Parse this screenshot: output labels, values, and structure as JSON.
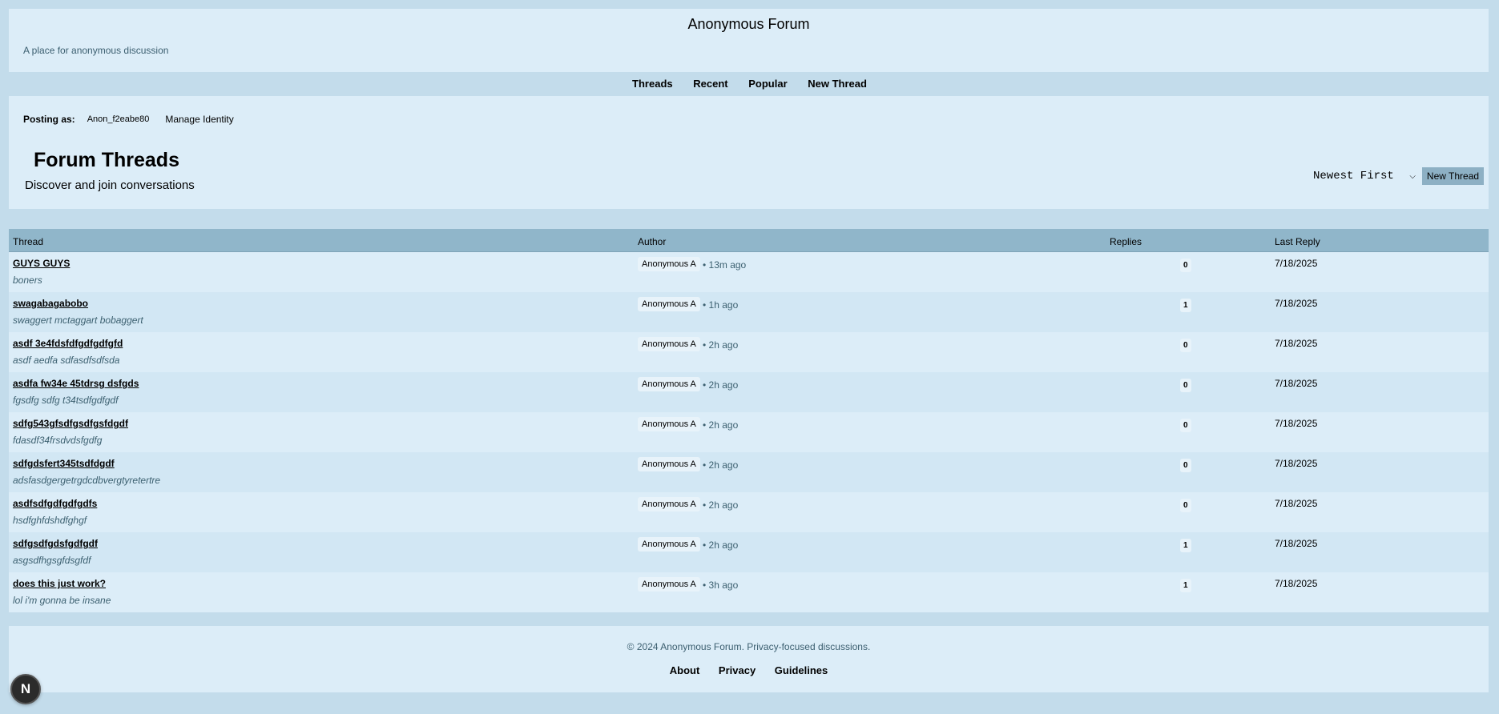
{
  "header": {
    "title": "Anonymous Forum",
    "tagline": "A place for anonymous discussion"
  },
  "nav": [
    "Threads",
    "Recent",
    "Popular",
    "New Thread"
  ],
  "identity": {
    "label": "Posting as:",
    "name": "Anon_f2eabe80",
    "manage": "Manage Identity"
  },
  "page": {
    "title": "Forum Threads",
    "subtitle": "Discover and join conversations"
  },
  "controls": {
    "sort_selected": "Newest First",
    "new_thread_label": "New Thread"
  },
  "table": {
    "headers": [
      "Thread",
      "Author",
      "Replies",
      "Last Reply"
    ],
    "rows": [
      {
        "title": "GUYS GUYS",
        "excerpt": "boners",
        "author": "Anonymous A",
        "time": "• 13m ago",
        "replies": "0",
        "last_reply": "7/18/2025"
      },
      {
        "title": "swagabagabobo",
        "excerpt": "swaggert mctaggart bobaggert",
        "author": "Anonymous A",
        "time": "• 1h ago",
        "replies": "1",
        "last_reply": "7/18/2025"
      },
      {
        "title": "asdf 3e4fdsfdfgdfgdfgfd",
        "excerpt": "asdf aedfa sdfasdfsdfsda",
        "author": "Anonymous A",
        "time": "• 2h ago",
        "replies": "0",
        "last_reply": "7/18/2025"
      },
      {
        "title": "asdfa fw34e 45tdrsg dsfgds",
        "excerpt": "fgsdfg sdfg t34tsdfgdfgdf",
        "author": "Anonymous A",
        "time": "• 2h ago",
        "replies": "0",
        "last_reply": "7/18/2025"
      },
      {
        "title": "sdfg543gfsdfgsdfgsfdgdf",
        "excerpt": "fdasdf34frsdvdsfgdfg",
        "author": "Anonymous A",
        "time": "• 2h ago",
        "replies": "0",
        "last_reply": "7/18/2025"
      },
      {
        "title": "sdfgdsfert345tsdfdgdf",
        "excerpt": "adsfasdgergetrgdcdbvergtyretertre",
        "author": "Anonymous A",
        "time": "• 2h ago",
        "replies": "0",
        "last_reply": "7/18/2025"
      },
      {
        "title": "asdfsdfgdfgdfgdfs",
        "excerpt": "hsdfghfdshdfghgf",
        "author": "Anonymous A",
        "time": "• 2h ago",
        "replies": "0",
        "last_reply": "7/18/2025"
      },
      {
        "title": "sdfgsdfgdsfgdfgdf",
        "excerpt": "asgsdfhgsgfdsgfdf",
        "author": "Anonymous A",
        "time": "• 2h ago",
        "replies": "1",
        "last_reply": "7/18/2025"
      },
      {
        "title": "does this just work?",
        "excerpt": "lol i'm gonna be insane",
        "author": "Anonymous A",
        "time": "• 3h ago",
        "replies": "1",
        "last_reply": "7/18/2025"
      }
    ]
  },
  "footer": {
    "copyright": "© 2024 Anonymous Forum. Privacy-focused discussions.",
    "links": [
      "About",
      "Privacy",
      "Guidelines"
    ]
  },
  "fab": {
    "label": "N",
    "icon": "next-logo-icon"
  }
}
